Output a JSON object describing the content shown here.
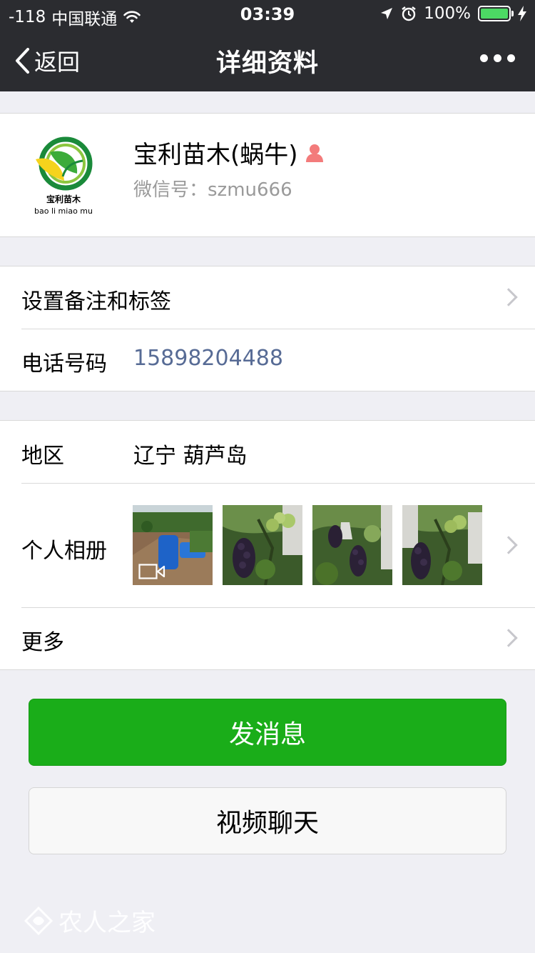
{
  "status_bar": {
    "signal": "-118",
    "carrier": "中国联通",
    "time": "03:39",
    "battery": "100%"
  },
  "nav": {
    "back_label": "返回",
    "title": "详细资料"
  },
  "profile": {
    "name": "宝利苗木(蜗牛)",
    "wechat_id": "微信号：szmu666",
    "logo_text_cn": "宝利苗木",
    "logo_text_en": "bao li miao mu"
  },
  "cells": {
    "remark_label": "设置备注和标签",
    "phone_label": "电话号码",
    "phone_value": "15898204488",
    "region_label": "地区",
    "region_value": "辽宁 葫芦岛",
    "album_label": "个人相册",
    "more_label": "更多"
  },
  "buttons": {
    "message": "发消息",
    "video_chat": "视频聊天"
  },
  "watermark": "农人之家",
  "colors": {
    "nav_bg": "#2b2c30",
    "primary_green": "#1aad19",
    "link_blue": "#576b95",
    "page_bg": "#efeff4"
  }
}
